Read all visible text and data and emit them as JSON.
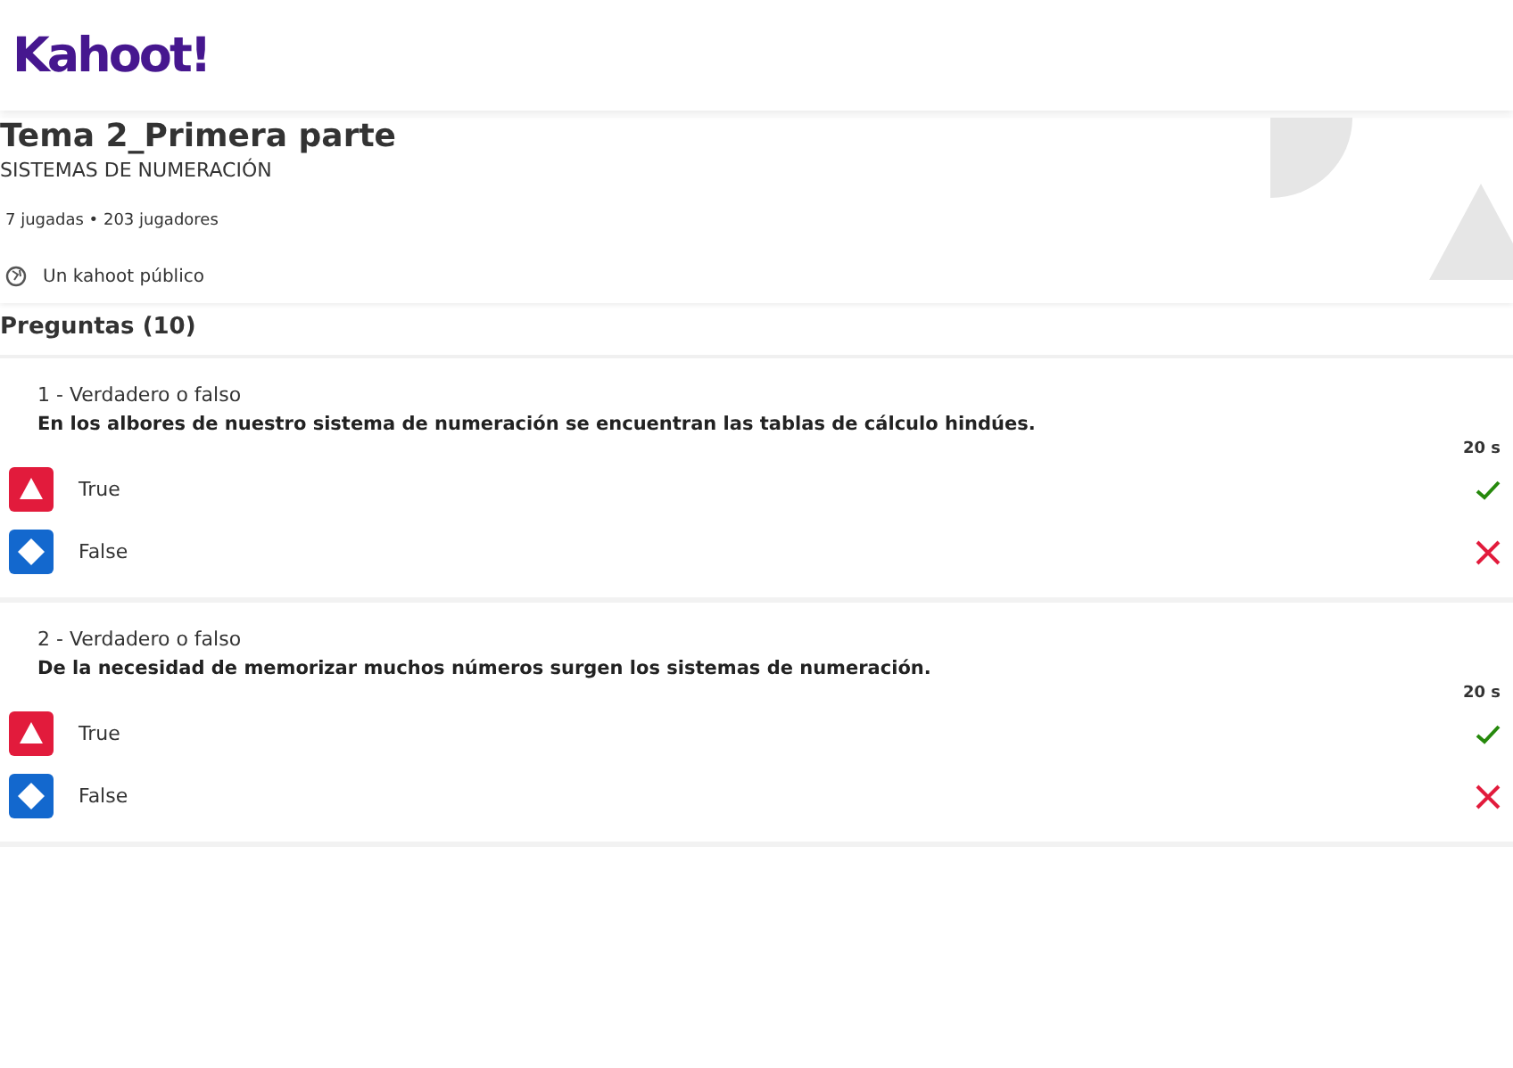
{
  "logo": "Kahoot!",
  "kahoot": {
    "title": "Tema 2_Primera parte",
    "subtitle": "SISTEMAS DE NUMERACIÓN",
    "stats": "7 jugadas • 203 jugadores",
    "visibility": "Un kahoot público"
  },
  "questions_heading": "Preguntas (10)",
  "questions": [
    {
      "type": "1 - Verdadero o falso",
      "text": "En los albores de nuestro sistema de numeración se encuentran las tablas de cálculo hindúes.",
      "time": "20 s",
      "answers": [
        {
          "kind": "triangle",
          "label": "True",
          "correct": true
        },
        {
          "kind": "diamond",
          "label": "False",
          "correct": false
        }
      ]
    },
    {
      "type": "2 - Verdadero o falso",
      "text": "De la necesidad de memorizar muchos números surgen los sistemas de numeración.",
      "time": "20 s",
      "answers": [
        {
          "kind": "triangle",
          "label": "True",
          "correct": true
        },
        {
          "kind": "diamond",
          "label": "False",
          "correct": false
        }
      ]
    }
  ]
}
